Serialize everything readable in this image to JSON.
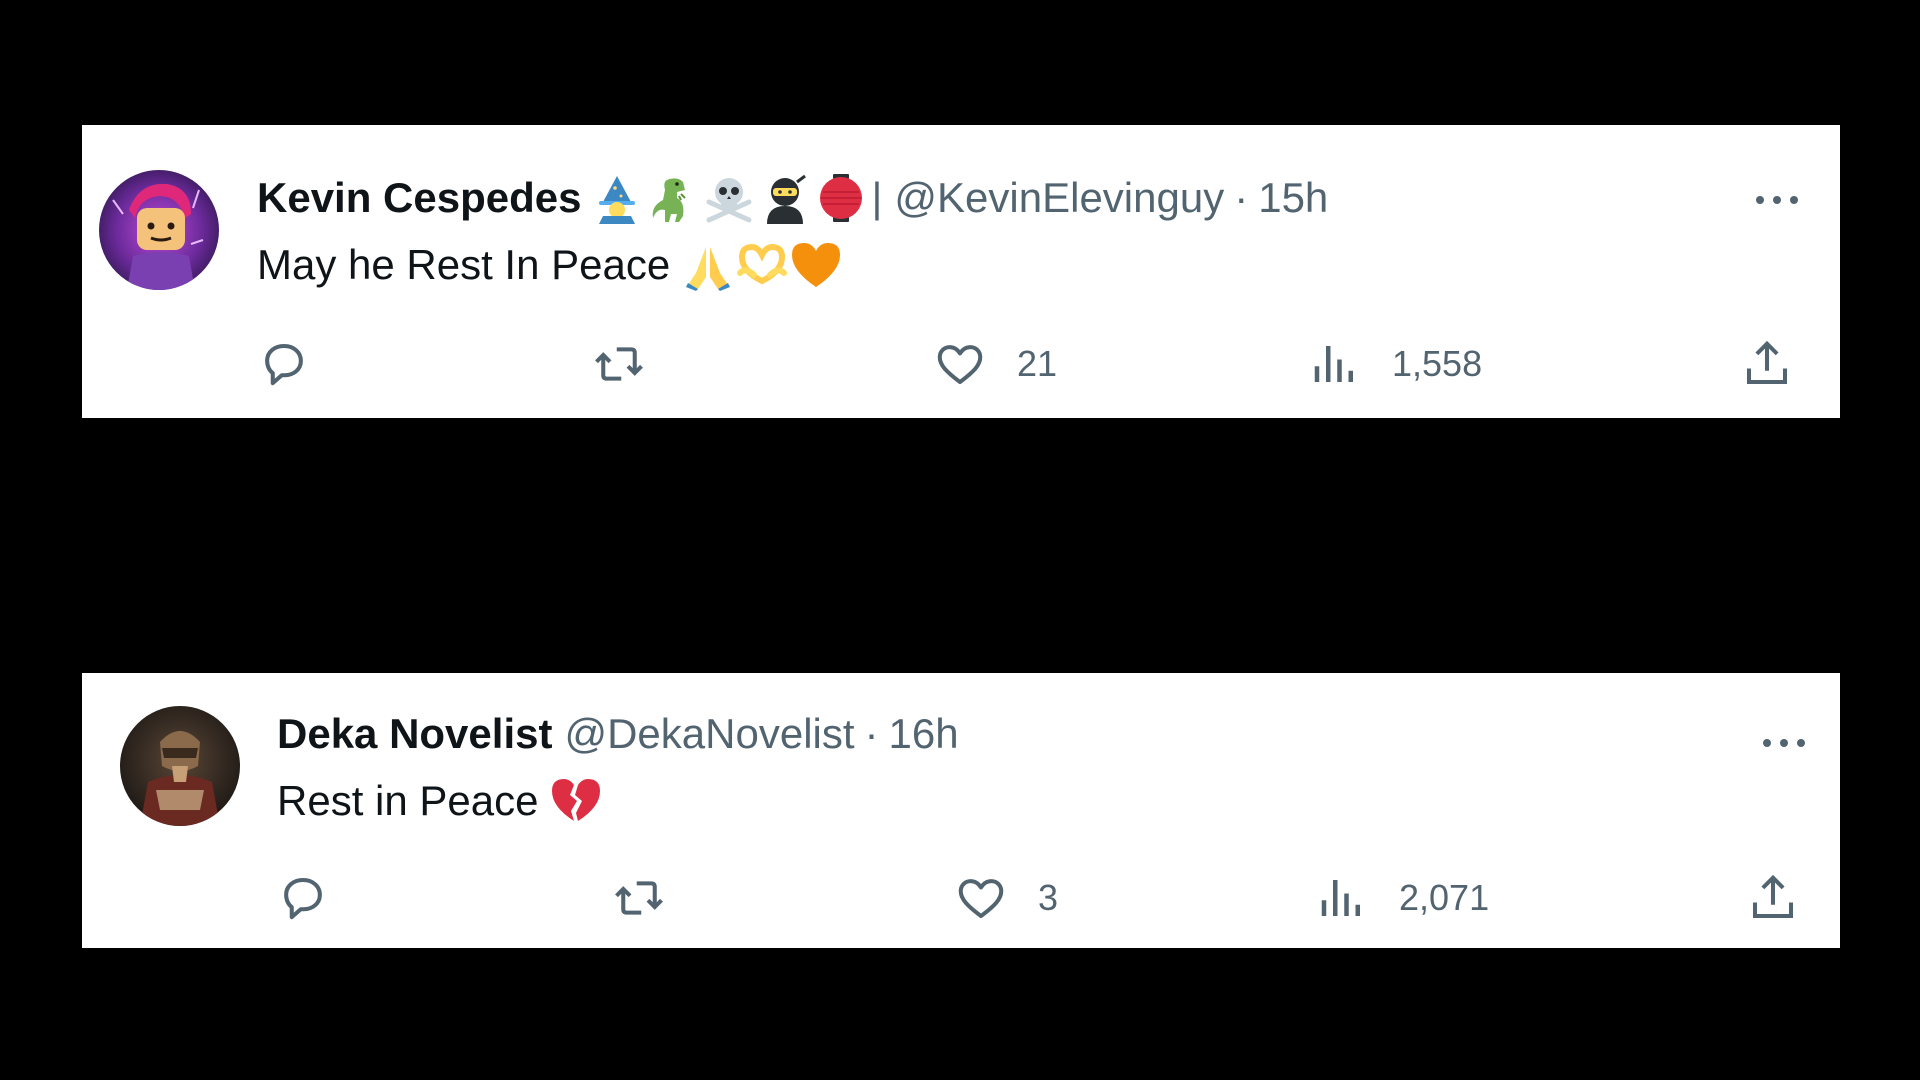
{
  "tweets": [
    {
      "display_name": "Kevin Cespedes",
      "name_emojis": [
        "mage-emoji",
        "t-rex-emoji",
        "skull-crossbones-emoji",
        "ninja-emoji",
        "red-lantern-emoji"
      ],
      "separator": "|",
      "handle": "@KevinElevinguy",
      "dot": "·",
      "time": "15h",
      "text": "May he Rest In Peace",
      "text_emojis": [
        "folded-hands-emoji",
        "heart-hands-emoji",
        "orange-heart-emoji"
      ],
      "likes": "21",
      "views": "1,558"
    },
    {
      "display_name": "Deka Novelist",
      "handle": "@DekaNovelist",
      "dot": "·",
      "time": "16h",
      "text": "Rest in Peace",
      "text_emojis": [
        "broken-heart-emoji"
      ],
      "likes": "3",
      "views": "2,071"
    }
  ],
  "colors": {
    "background": "#000000",
    "card": "#ffffff",
    "primary_text": "#0f1419",
    "secondary_text": "#536471"
  }
}
